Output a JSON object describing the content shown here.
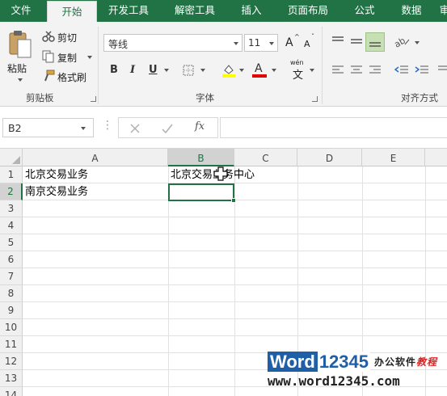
{
  "tabs": [
    {
      "label": "文件",
      "active": false
    },
    {
      "label": "开始",
      "active": true
    },
    {
      "label": "开发工具",
      "active": false
    },
    {
      "label": "解密工具",
      "active": false
    },
    {
      "label": "插入",
      "active": false
    },
    {
      "label": "页面布局",
      "active": false
    },
    {
      "label": "公式",
      "active": false
    },
    {
      "label": "数据",
      "active": false
    },
    {
      "label": "审",
      "active": false
    }
  ],
  "ribbon": {
    "clipboard": {
      "paste": "粘贴",
      "cut": "剪切",
      "copy": "复制",
      "format_painter": "格式刷",
      "group_label": "剪贴板"
    },
    "font": {
      "font_name": "等线",
      "font_size": "11",
      "increase_size": "A",
      "decrease_size": "A",
      "bold": "B",
      "italic": "I",
      "underline": "U",
      "font_color": "A",
      "pinyin": "文",
      "pinyin_top": "wén",
      "group_label": "字体"
    },
    "alignment": {
      "group_label": "对齐方式"
    }
  },
  "formula_bar": {
    "name_box": "B2",
    "function_label": "fx",
    "formula": ""
  },
  "sheet": {
    "columns": [
      "A",
      "B",
      "C",
      "D",
      "E"
    ],
    "selected_column": "B",
    "rows": [
      "1",
      "2",
      "3",
      "4",
      "5",
      "6",
      "7",
      "8",
      "9",
      "10",
      "11",
      "12",
      "13",
      "14"
    ],
    "selected_row": "2",
    "cells": {
      "A1": "北京交易业务",
      "B1": "北京交易业务中心",
      "A2": "南京交易业务"
    },
    "active_cell": "B2"
  },
  "watermark": {
    "logo_word": "Word",
    "logo_num": "12345",
    "tagline_a": "办公软件",
    "tagline_b": "教程",
    "url": "www.word12345.com"
  },
  "colors": {
    "accent": "#217346",
    "ribbon_bg": "#f3f3f3",
    "selected_header": "#d2d2d2"
  }
}
